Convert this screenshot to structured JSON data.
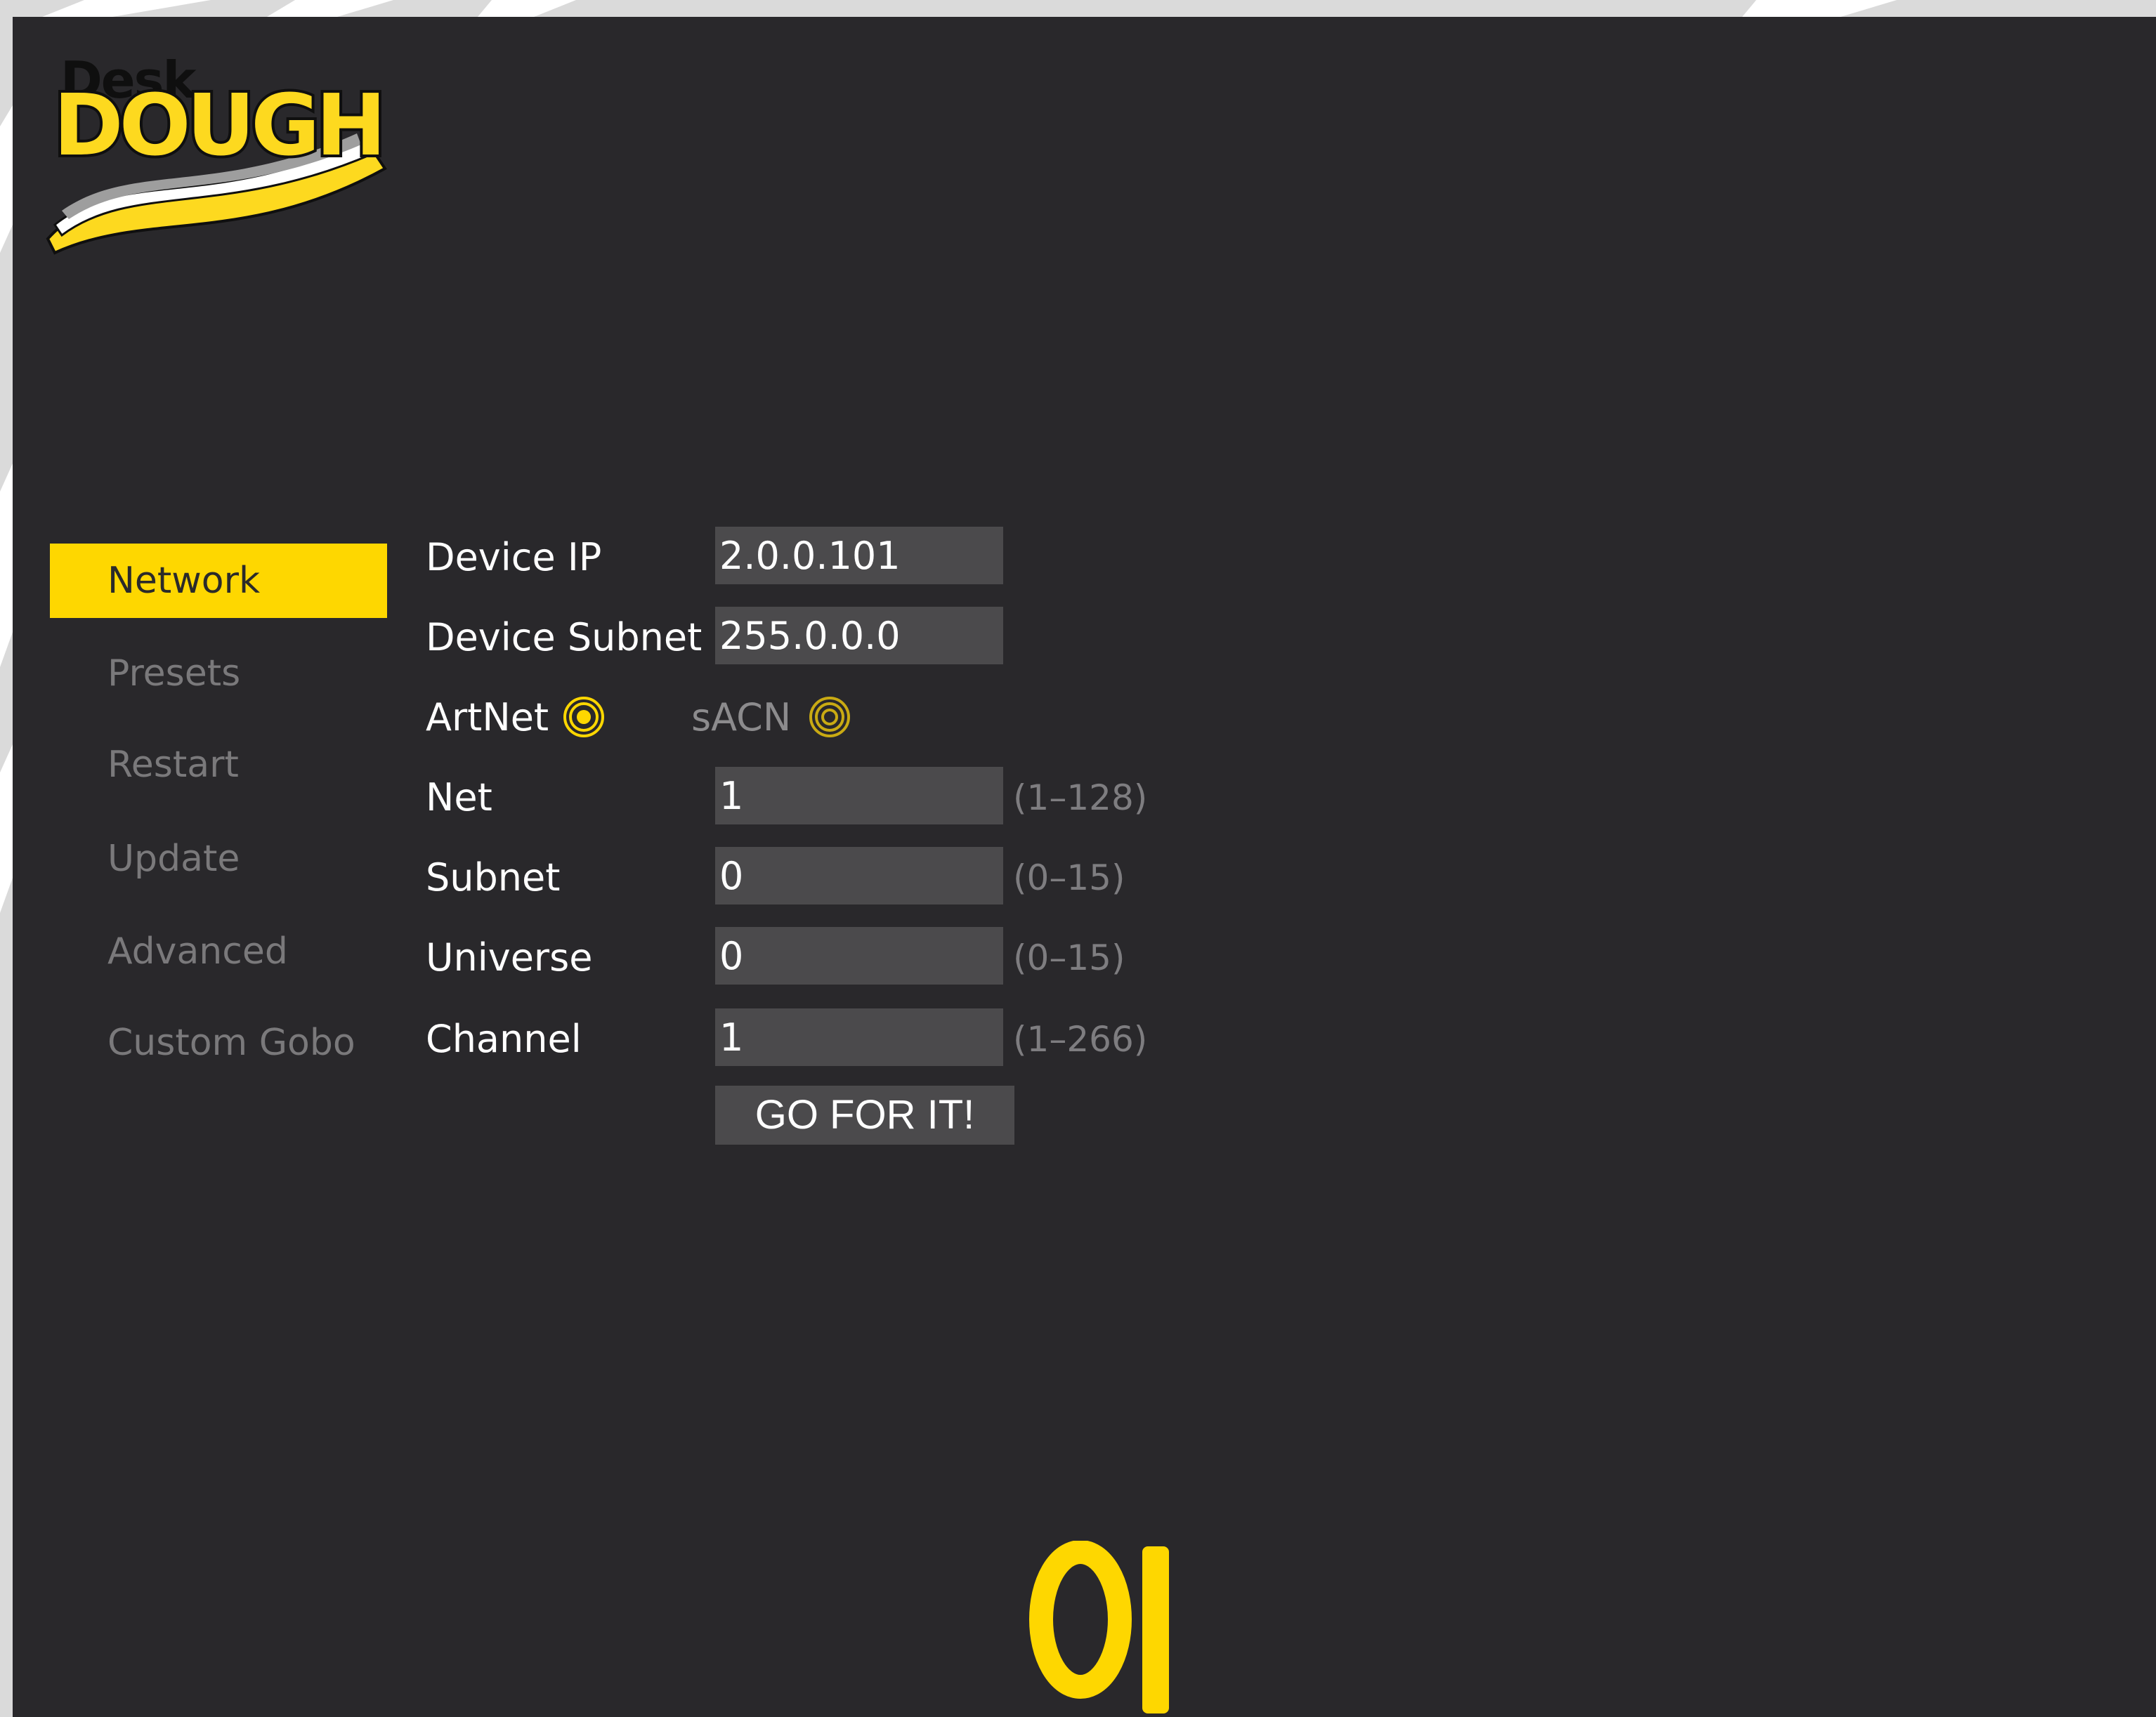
{
  "brand": {
    "logo_small": "Desk",
    "logo_big": "DOUGH",
    "footer_mark": "oI"
  },
  "colors": {
    "accent": "#fed700",
    "background": "#29282b",
    "field": "#4b4a4c",
    "nav_inactive": "#7a797b",
    "range_hint": "#7e7d80"
  },
  "sidebar": {
    "items": [
      {
        "label": "Network",
        "active": true
      },
      {
        "label": "Presets",
        "active": false
      },
      {
        "label": "Restart",
        "active": false
      },
      {
        "label": "Update",
        "active": false
      },
      {
        "label": "Advanced",
        "active": false
      },
      {
        "label": "Custom Gobo",
        "active": false
      }
    ]
  },
  "form": {
    "device_ip": {
      "label": "Device IP",
      "value": "2.0.0.101"
    },
    "device_subnet": {
      "label": "Device Subnet",
      "value": "255.0.0.0"
    },
    "protocol": {
      "artnet_label": "ArtNet",
      "sacn_label": "sACN",
      "selected": "ArtNet"
    },
    "net": {
      "label": "Net",
      "value": "1",
      "range": "(1–128)"
    },
    "subnet": {
      "label": "Subnet",
      "value": "0",
      "range": "(0–15)"
    },
    "universe": {
      "label": "Universe",
      "value": "0",
      "range": "(0–15)"
    },
    "channel": {
      "label": "Channel",
      "value": "1",
      "range": "(1–266)"
    },
    "submit_label": "GO FOR IT!"
  }
}
